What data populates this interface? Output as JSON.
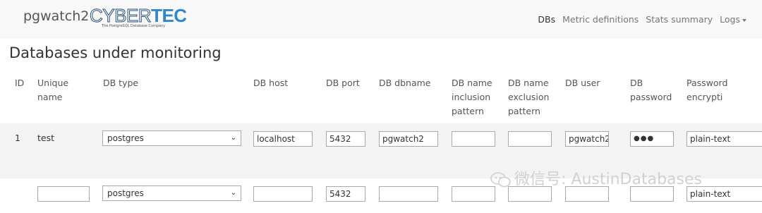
{
  "navbar": {
    "brand": "pgwatch2",
    "logo_part1": "CYBER",
    "logo_part2": "TEC",
    "logo_tagline": "The PostgreSQL Database Company",
    "links": [
      "DBs",
      "Metric definitions",
      "Stats summary",
      "Logs"
    ]
  },
  "page_title": "Databases under monitoring",
  "table": {
    "headers": [
      "ID",
      "Unique\nname",
      "DB type",
      "DB host",
      "DB port",
      "DB dbname",
      "DB name\ninclusion\npattern",
      "DB name\nexclusion\npattern",
      "DB user",
      "DB\npassword",
      "Password encrypti"
    ],
    "row1": {
      "id": "1",
      "unique_name": "test",
      "db_type": "postgres",
      "db_host": "localhost",
      "db_port": "5432",
      "db_dbname": "pgwatch2",
      "inclusion": "",
      "exclusion": "",
      "db_user": "pgwatch2",
      "db_password": "●●●",
      "password_encryption": "plain-text"
    },
    "new_row": {
      "unique_name": "",
      "db_type": "postgres",
      "db_host": "",
      "db_port": "5432",
      "db_dbname": "",
      "inclusion": "",
      "exclusion": "",
      "db_user": "",
      "db_password": "",
      "password_encryption": "plain-text"
    }
  },
  "watermark": "微信号: AustinDatabases",
  "colors": {
    "accent": "#2f86c8",
    "navbar_bg": "#f8f8f8",
    "row_bg": "#f3f3f3"
  }
}
